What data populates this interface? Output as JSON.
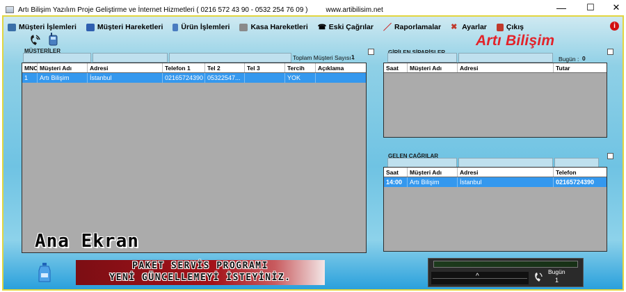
{
  "window": {
    "title": "Artı Bilişim Yazılım Proje Geliştirme ve İnternet Hizmetleri ( 0216 572 43 90 - 0532 254 76 09 )",
    "url": "www.artibilisim.net",
    "minimize": "—",
    "maximize": "☐",
    "close": "✕"
  },
  "menu": [
    {
      "label": "Müşteri İşlemleri",
      "icon": "customer-icon",
      "color": "#3a6fa8"
    },
    {
      "label": "Müşteri Hareketleri",
      "icon": "customer-activity-icon",
      "color": "#2f5fb0"
    },
    {
      "label": "Ürün İşlemleri",
      "icon": "product-icon",
      "color": "#4a7cc0"
    },
    {
      "label": "Kasa Hareketleri",
      "icon": "cash-register-icon",
      "color": "#888888"
    },
    {
      "label": "Eski Çağrılar",
      "icon": "old-calls-icon",
      "color": "#2a2a2a"
    },
    {
      "label": "Raporlamalar",
      "icon": "reports-icon",
      "color": "#cc2222"
    },
    {
      "label": "Ayarlar",
      "icon": "settings-icon",
      "color": "#c0392b"
    },
    {
      "label": "Çıkış",
      "icon": "exit-icon",
      "color": "#c0392b"
    }
  ],
  "brand": "Artı Bilişim",
  "customers": {
    "section_label": "MÜŞTERİLER",
    "total_label": "Toplam Müşteri Sayısı :",
    "total_value": "1",
    "columns": [
      "MNO",
      "Müşteri Adı",
      "Adresi",
      "Telefon 1",
      "Tel 2",
      "Tel 3",
      "Tercih",
      "Açıklama"
    ],
    "rows": [
      [
        "1",
        "Artı Bilişim",
        "İstanbul",
        "02165724390",
        "05322547...",
        "",
        "YOK",
        ""
      ]
    ]
  },
  "orders": {
    "section_label": "GİRİLEN SİPARİŞLER",
    "today_label": "Bugün :",
    "today_value": "0",
    "columns": [
      "Saat",
      "Müşteri Adı",
      "Adresi",
      "Tutar"
    ],
    "rows": []
  },
  "calls": {
    "section_label": "GELEN ÇAĞRILAR",
    "columns": [
      "Saat",
      "Müşteri Adı",
      "Adresi",
      "Telefon"
    ],
    "rows": [
      [
        "14:00",
        "Artı Bilişim",
        "İstanbul",
        "02165724390"
      ]
    ]
  },
  "screen_name": "Ana Ekran",
  "banner": {
    "line1": "PAKET SERVİS PROGRAMI",
    "line2": "YENİ GÜNCELLEMEYİ İSTEYİNİZ."
  },
  "status": {
    "wave_mark": "^",
    "today_label": "Bugün",
    "today_count": "1"
  },
  "colors": {
    "accent": "#e2232a",
    "selected_row": "#3498ee",
    "frame_border": "#e2d640"
  }
}
